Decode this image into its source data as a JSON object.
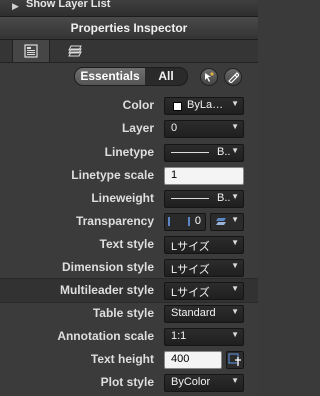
{
  "top": {
    "title": "Show Layer List"
  },
  "inspector": {
    "title": "Properties Inspector"
  },
  "tabs": [
    {
      "icon": "properties-tab-icon"
    },
    {
      "icon": "layers-tab-icon"
    }
  ],
  "toggle": {
    "essentials": "Essentials",
    "all": "All"
  },
  "rows": [
    {
      "label": "Color",
      "value": "ByLa…"
    },
    {
      "label": "Layer",
      "value": "0"
    },
    {
      "label": "Linetype",
      "value": "B.."
    },
    {
      "label": "Linetype scale",
      "value": "1"
    },
    {
      "label": "Lineweight",
      "value": "B.."
    },
    {
      "label": "Transparency",
      "value": "0"
    },
    {
      "label": "Text style",
      "value": "Lサイズ"
    },
    {
      "label": "Dimension style",
      "value": "Lサイズ"
    },
    {
      "label": "Multileader style",
      "value": "Lサイズ"
    },
    {
      "label": "Table style",
      "value": "Standard"
    },
    {
      "label": "Annotation scale",
      "value": "1:1"
    },
    {
      "label": "Text height",
      "value": "400"
    },
    {
      "label": "Plot style",
      "value": "ByColor"
    }
  ],
  "colors": {
    "highlight": "#5a86c6"
  }
}
